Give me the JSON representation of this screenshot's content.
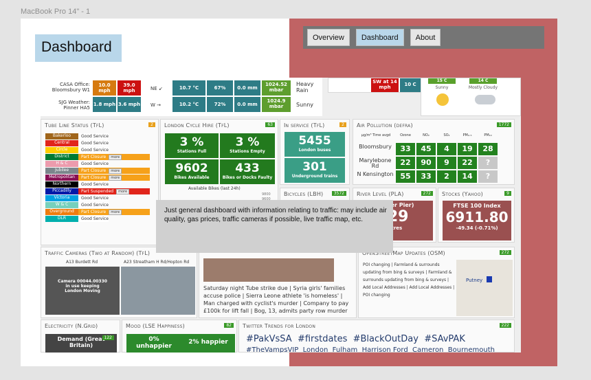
{
  "frame_label": "MacBook Pro 14\" - 1",
  "title": "Dashboard",
  "nav": [
    "Overview",
    "Dashboard",
    "About"
  ],
  "note": "Just general dashboard with information relating to traffic: may include air quality, gas prices, traffic cameras if possible, live traffic map, etc.",
  "weather": {
    "rows": [
      {
        "place": "CASA Office: Bloomsbury W1",
        "speed": "10.0 mph",
        "gust": "39.0 mph",
        "dir": "NE ↙",
        "temp": "10.7 °C",
        "hum": "67%",
        "rain": "0.0 mm",
        "press": "1024.52 mbar",
        "desc": "Heavy Rain"
      },
      {
        "place": "SJG Weather: Pinner HA5",
        "speed": "1.8 mph",
        "gust": "3.6 mph",
        "dir": "W →",
        "temp": "10.2 °C",
        "hum": "72%",
        "rain": "0.0 mm",
        "press": "1024.9 mbar",
        "desc": "Sunny"
      }
    ],
    "wind_label": "SW at 14 mph",
    "temp_label": "10 C",
    "forecast": [
      {
        "t": "15 C",
        "d": "Sunny"
      },
      {
        "t": "14 C",
        "d": "Mostly Cloudy"
      }
    ]
  },
  "tube": {
    "title": "Tube Line Status (TfL)",
    "badge": "2",
    "lines": [
      {
        "n": "Bakerloo",
        "s": "Good Service",
        "c": "#a0651a",
        "sc": "#fff"
      },
      {
        "n": "Central",
        "s": "Good Service",
        "c": "#e1251b",
        "sc": "#fff"
      },
      {
        "n": "Circle",
        "s": "Good Service",
        "c": "#ffcd00",
        "sc": "#fff"
      },
      {
        "n": "District",
        "s": "Part Closure",
        "c": "#007a33",
        "sc": "#f6a11a",
        "m": true
      },
      {
        "n": "H & C",
        "s": "Good Service",
        "c": "#ec9bad",
        "sc": "#fff"
      },
      {
        "n": "Jubilee",
        "s": "Part Closure",
        "c": "#7b868c",
        "sc": "#f6a11a",
        "m": true
      },
      {
        "n": "Metropolitan",
        "s": "Part Closure",
        "c": "#870f54",
        "sc": "#f6a11a",
        "m": true
      },
      {
        "n": "Northern",
        "s": "Good Service",
        "c": "#000000",
        "sc": "#fff"
      },
      {
        "n": "Piccadilly",
        "s": "Part Suspended",
        "c": "#0019a8",
        "sc": "#e1251b",
        "m": true
      },
      {
        "n": "Victoria",
        "s": "Good Service",
        "c": "#00a0e2",
        "sc": "#fff"
      },
      {
        "n": "W & C",
        "s": "Good Service",
        "c": "#76d0bd",
        "sc": "#fff"
      },
      {
        "n": "Overground",
        "s": "Part Closure",
        "c": "#ee7c0e",
        "sc": "#f6a11a",
        "m": true
      },
      {
        "n": "DLR",
        "s": "Good Service",
        "c": "#00afad",
        "sc": "#fff"
      }
    ]
  },
  "cycle": {
    "title": "London Cycle Hire (TfL)",
    "badge": "63",
    "full": "3 %",
    "full_l": "Stations Full",
    "empty": "3 %",
    "empty_l": "Stations Empty",
    "avail": "9602",
    "avail_l": "Bikes Available",
    "faulty": "433",
    "faulty_l": "Bikes or Docks Faulty",
    "chart_l": "Available Bikes (last 24h)",
    "y1": "9800",
    "y2": "9600"
  },
  "service": {
    "title": "In service (TfL)",
    "badge": "2",
    "buses": "5455",
    "buses_l": "London buses",
    "trains": "301",
    "trains_l": "Underground trains"
  },
  "air": {
    "title": "Air Pollution (defra)",
    "badge": "1772",
    "cols": [
      "µg/m³ Time avgd",
      "Ozone",
      "NO₂",
      "SO₂",
      "PM₂.₅",
      "PM₁₀"
    ],
    "rows": [
      {
        "s": "Bloomsbury",
        "v": [
          "33",
          "45",
          "4",
          "19",
          "28"
        ]
      },
      {
        "s": "Marylebone Rd",
        "v": [
          "22",
          "90",
          "9",
          "22",
          "?"
        ]
      },
      {
        "s": "N Kensington",
        "v": [
          "55",
          "33",
          "2",
          "14",
          "?"
        ]
      }
    ]
  },
  "bicycles": {
    "title": "Bicycles (LBH)",
    "badge": "3572"
  },
  "river": {
    "title": "River Level (PLA)",
    "badge": "272",
    "sub": "(Tower Pier)",
    "val": ".29",
    "unit": "etres"
  },
  "stocks": {
    "title": "Stocks (Yahoo)",
    "badge": "9",
    "name": "FTSE 100 Index",
    "val": "6911.80",
    "chg": "-49.34 (-0.71%)"
  },
  "cams": {
    "title": "Traffic Cameras (Two at Random) (TfL)",
    "c1": "A13 Burdett Rd",
    "c2": "A23 Streatham H Rd/Hopton Rd",
    "msg": "Camera 00044.00330 in use keeping London Moving"
  },
  "news": {
    "text": "Saturday night Tube strike due | Syria girls' families accuse police | Sierra Leone athlete 'is homeless' | Man charged with cyclist's murder | Company to pay £100k for lift fall | Bog, 13, admits party row murder"
  },
  "osm": {
    "title": "OpenStreetMap Updates (OSM)",
    "badge": "272",
    "text": "POI changing | Farmland & surrounds updating from bing & surveys | Farmland & surrounds updating from bing & surveys | Add Local Addresses | Add Local Addresses | POI changing",
    "map_place": "Putney"
  },
  "elec": {
    "title": "Electricity (N.Grid)",
    "badge": "122",
    "label": "Demand (Great Britain)"
  },
  "mood": {
    "title": "Mood (LSE Happiness)",
    "badge": "82",
    "unhappier": "0% unhappier",
    "happier": "2% happier"
  },
  "twitter": {
    "title": "Twitter Trends for London",
    "badge": "222",
    "tags": [
      "#PakVsSA",
      "#firstdates",
      "#BlackOutDay",
      "#SAvPAK"
    ],
    "tags2": [
      "#TheVampsVIP",
      "London",
      "Fulham",
      "Harrison Ford",
      "Cameron",
      "Bournemouth"
    ]
  }
}
